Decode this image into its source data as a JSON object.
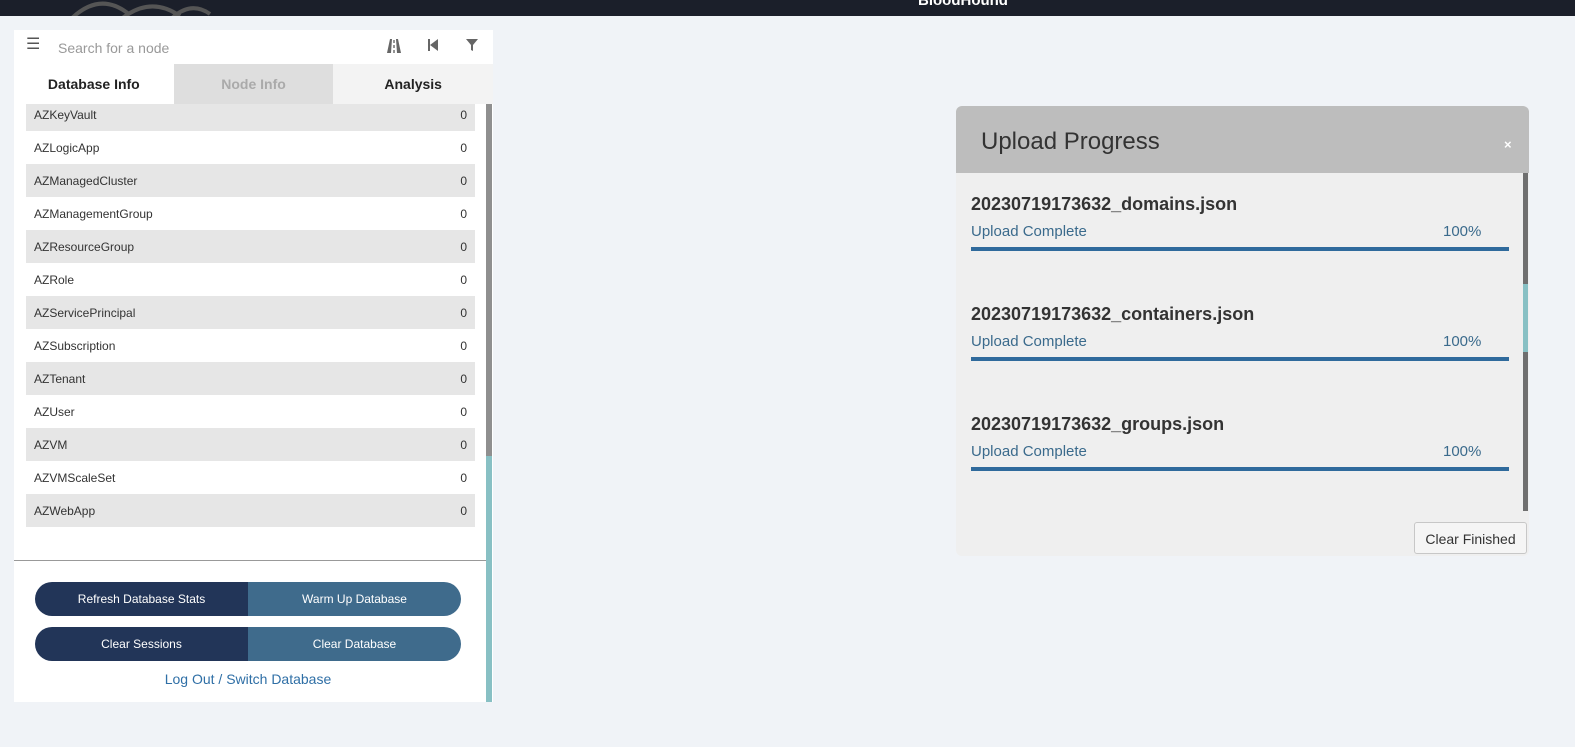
{
  "topbar": {
    "brand": "BloodHound"
  },
  "search": {
    "placeholder": "Search for a node"
  },
  "tabs": [
    {
      "label": "Database Info"
    },
    {
      "label": "Node Info"
    },
    {
      "label": "Analysis"
    }
  ],
  "stats": [
    {
      "label": "AZKeyVault",
      "count": "0"
    },
    {
      "label": "AZLogicApp",
      "count": "0"
    },
    {
      "label": "AZManagedCluster",
      "count": "0"
    },
    {
      "label": "AZManagementGroup",
      "count": "0"
    },
    {
      "label": "AZResourceGroup",
      "count": "0"
    },
    {
      "label": "AZRole",
      "count": "0"
    },
    {
      "label": "AZServicePrincipal",
      "count": "0"
    },
    {
      "label": "AZSubscription",
      "count": "0"
    },
    {
      "label": "AZTenant",
      "count": "0"
    },
    {
      "label": "AZUser",
      "count": "0"
    },
    {
      "label": "AZVM",
      "count": "0"
    },
    {
      "label": "AZVMScaleSet",
      "count": "0"
    },
    {
      "label": "AZWebApp",
      "count": "0"
    }
  ],
  "buttons": {
    "refresh": "Refresh Database Stats",
    "warmup": "Warm Up Database",
    "clear_sessions": "Clear Sessions",
    "clear_database": "Clear Database",
    "logout": "Log Out / Switch Database"
  },
  "upload": {
    "title": "Upload Progress",
    "close": "×",
    "files": [
      {
        "name": "20230719173632_domains.json",
        "status": "Upload Complete",
        "percent": "100%",
        "progress": 1.0
      },
      {
        "name": "20230719173632_containers.json",
        "status": "Upload Complete",
        "percent": "100%",
        "progress": 1.0
      },
      {
        "name": "20230719173632_groups.json",
        "status": "Upload Complete",
        "percent": "100%",
        "progress": 1.0
      }
    ],
    "clear_finished": "Clear Finished"
  },
  "colors": {
    "primary_button": "#223558",
    "secondary_button": "#3f6b8c",
    "progress_bar": "#2f6a9c",
    "link": "#2f6fa6"
  },
  "icons": {
    "menu": "hamburger-icon",
    "pathfinding": "road-icon",
    "back": "step-backward-icon",
    "filter": "filter-icon"
  }
}
